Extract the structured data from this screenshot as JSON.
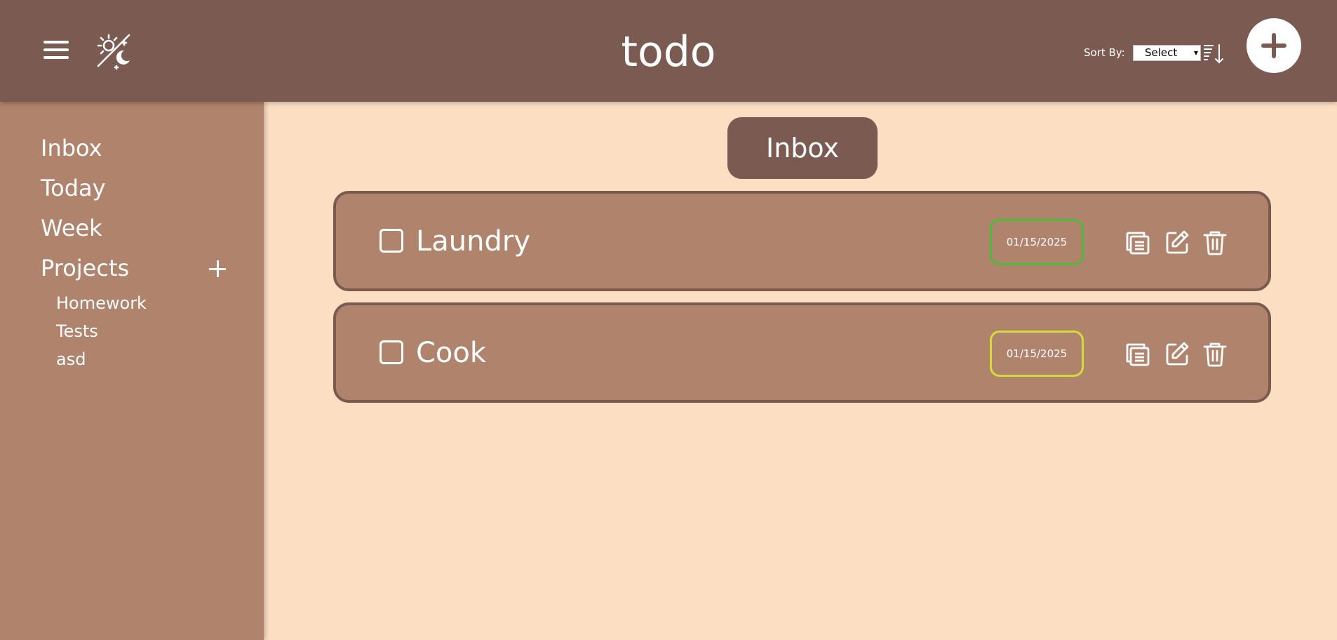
{
  "header": {
    "title": "todo",
    "sort_label": "Sort By:",
    "sort_value": "Select",
    "menu_icon": "hamburger-menu-icon",
    "theme_icon": "sun-moon-theme-icon",
    "sort_direction_icon": "sort-descending-icon",
    "add_icon": "plus-icon"
  },
  "sidebar": {
    "items": [
      {
        "label": "Inbox"
      },
      {
        "label": "Today"
      },
      {
        "label": "Week"
      },
      {
        "label": "Projects"
      }
    ],
    "projects": [
      {
        "label": "Homework"
      },
      {
        "label": "Tests"
      },
      {
        "label": "asd"
      }
    ]
  },
  "main": {
    "section_title": "Inbox",
    "tasks": [
      {
        "name": "Laundry",
        "date": "01/15/2025",
        "priority_color": "#4cbb3a"
      },
      {
        "name": "Cook",
        "date": "01/15/2025",
        "priority_color": "#d4dc3a"
      }
    ]
  },
  "colors": {
    "header_bg": "#7b5a52",
    "sidebar_bg": "#b0836c",
    "page_bg": "#fcdec3",
    "task_bg": "#b0836c",
    "task_border": "#7b5a52"
  }
}
